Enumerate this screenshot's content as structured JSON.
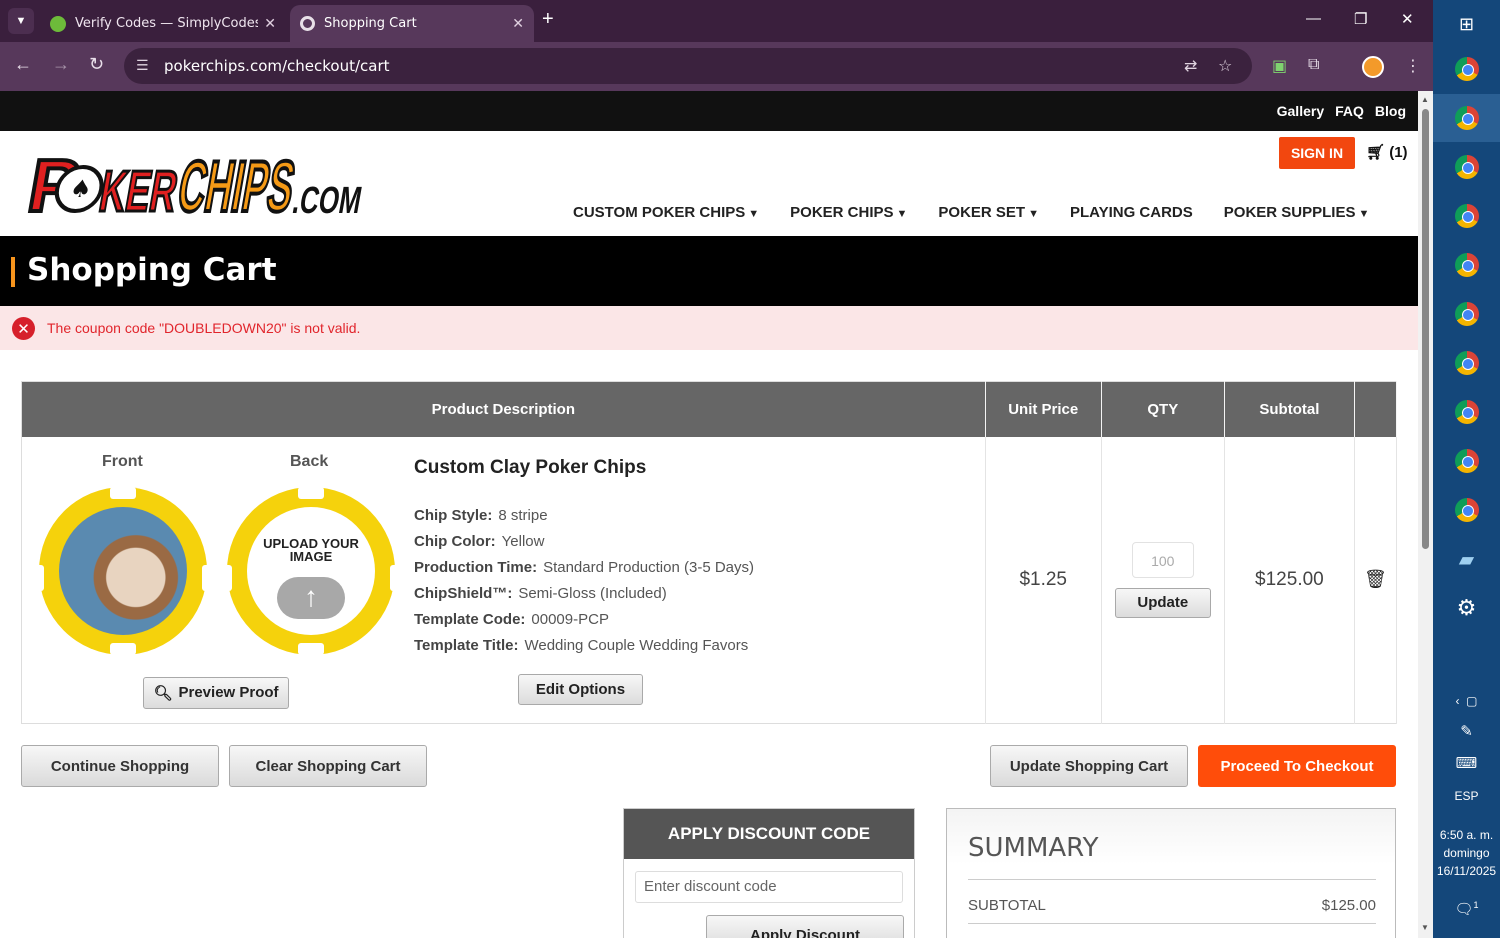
{
  "browser": {
    "tabs": [
      {
        "title": "Verify Codes — SimplyCodes",
        "active": false
      },
      {
        "title": "Shopping Cart",
        "active": true
      }
    ],
    "url": "pokerchips.com/checkout/cart"
  },
  "site": {
    "top_links": [
      "Gallery",
      "FAQ",
      "Blog"
    ],
    "sign_in": "SIGN IN",
    "cart_count": "(1)",
    "nav": [
      {
        "label": "CUSTOM POKER CHIPS",
        "dropdown": true
      },
      {
        "label": "POKER CHIPS",
        "dropdown": true
      },
      {
        "label": "POKER SET",
        "dropdown": true
      },
      {
        "label": "PLAYING CARDS",
        "dropdown": false
      },
      {
        "label": "POKER SUPPLIES",
        "dropdown": true
      }
    ]
  },
  "page": {
    "title": "Shopping Cart",
    "error": "The coupon code \"DOUBLEDOWN20\" is not valid."
  },
  "cart": {
    "headers": {
      "product": "Product Description",
      "unit_price": "Unit Price",
      "qty": "QTY",
      "subtotal": "Subtotal"
    },
    "item": {
      "front_label": "Front",
      "back_label": "Back",
      "back_chip_text": "UPLOAD YOUR IMAGE",
      "name": "Custom Clay Poker Chips",
      "attributes": [
        {
          "label": "Chip Style:",
          "value": "8 stripe"
        },
        {
          "label": "Chip Color:",
          "value": "Yellow"
        },
        {
          "label": "Production Time:",
          "value": "Standard Production (3-5 Days)"
        },
        {
          "label": "ChipShield™:",
          "value": "Semi-Gloss (Included)"
        },
        {
          "label": "Template Code:",
          "value": "00009-PCP"
        },
        {
          "label": "Template Title:",
          "value": "Wedding Couple Wedding Favors"
        }
      ],
      "preview_button": "Preview Proof",
      "edit_button": "Edit Options",
      "unit_price": "$1.25",
      "qty": "100",
      "update_button": "Update",
      "subtotal": "$125.00"
    },
    "actions": {
      "continue": "Continue Shopping",
      "clear": "Clear Shopping Cart",
      "update": "Update Shopping Cart",
      "checkout": "Proceed To Checkout"
    }
  },
  "discount": {
    "title": "APPLY DISCOUNT CODE",
    "placeholder": "Enter discount code",
    "button": "Apply Discount"
  },
  "summary": {
    "title": "SUMMARY",
    "subtotal_label": "SUBTOTAL",
    "subtotal_value": "$125.00"
  },
  "taskbar": {
    "language": "ESP",
    "time": "6:50 a. m.",
    "day": "domingo",
    "date": "16/11/2025",
    "notifications": "1"
  },
  "colors": {
    "accent_orange": "#ff4d0a",
    "error_red": "#e1252c",
    "header_bg": "#000000"
  }
}
